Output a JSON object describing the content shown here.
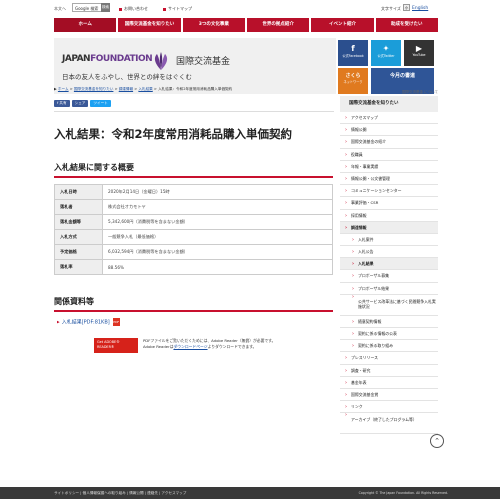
{
  "util": {
    "site_label": "本文へ",
    "search_value": "Google 検索",
    "search_btn": "検索",
    "links": [
      "お問い合わせ",
      "サイトマップ"
    ],
    "fontsize_label": "文字サイズ",
    "fontsize_small": "小",
    "fontsize_mid": "中",
    "fontsize_large": "大",
    "english": "English"
  },
  "gnav": [
    "ホーム",
    "国際交流基金を知りたい",
    "3つの文化事業",
    "世界の拠点紹介",
    "イベント紹介",
    "助成を受けたい"
  ],
  "banner": {
    "en_name_a": "JAPAN",
    "en_name_b": "FOUNDATION",
    "jp_name": "国際交流基金",
    "tagline": "日本の友人をふやし、世界との絆をはぐくむ"
  },
  "social": {
    "facebook": "公式Facebook",
    "twitter": "公式Twitter",
    "youtube": "YouTube",
    "sakura": "さくら",
    "sakura_sub": "ネットワーク",
    "kongetsu": "今月の書道",
    "about": "国際交流基金 について"
  },
  "breadcrumb": {
    "items": [
      "ホーム",
      "国際交流基金を知りたい",
      "調達情報",
      "入札結果"
    ],
    "current": "入札結果：令和2年度常用消耗品購入単価契約"
  },
  "share": {
    "fb": "f 共有",
    "share": "シェア",
    "tweet": "ツイート"
  },
  "main": {
    "title": "入札結果：令和2年度常用消耗品購入単価契約",
    "summary_heading": "入札結果に関する概要",
    "rows": [
      {
        "k": "入札日時",
        "v": "2020年2月14日（金曜日）15時"
      },
      {
        "k": "落札者",
        "v": "株式会社オカモトヤ"
      },
      {
        "k": "落札金額等",
        "v": "5,342,600円（消費税等を含まない金額）"
      },
      {
        "k": "入札方式",
        "v": "一般競争入札（最低価格）"
      },
      {
        "k": "予定価格",
        "v": "6,032,594円（消費税等を含まない金額）"
      },
      {
        "k": "落札率",
        "v": "88.56%"
      }
    ],
    "related_heading": "関係資料等",
    "doc_link": "入札結果[PDF:81KB]",
    "pdf_icon": "PDF",
    "adobe_badge": "Get ADOBE® READER®",
    "adobe_text_a": "PDFファイルをご覧いただくためには、Adobe Reader（無償）が必要です。",
    "adobe_text_b": "Adobe Readerは",
    "adobe_dl": "ダウンロードページ",
    "adobe_text_c": "よりダウンロードできます。"
  },
  "sidebar": {
    "head": "国際交流基金を知りたい",
    "items": [
      {
        "label": "アクセスマップ",
        "level": 0
      },
      {
        "label": "情報公開",
        "level": 0
      },
      {
        "label": "国際交流基金の紹介",
        "level": 0
      },
      {
        "label": "役職員",
        "level": 0
      },
      {
        "label": "年報・事業実績",
        "level": 0
      },
      {
        "label": "情報公開・公文書管理",
        "level": 0
      },
      {
        "label": "コミュニケーションセンター",
        "level": 0
      },
      {
        "label": "事業評価・CSR",
        "level": 0
      },
      {
        "label": "採用情報",
        "level": 0
      },
      {
        "label": "調達情報",
        "level": 0,
        "active": true
      },
      {
        "label": "入札案件",
        "level": 1
      },
      {
        "label": "入札公告",
        "level": 1
      },
      {
        "label": "入札結果",
        "level": 1,
        "active": true
      },
      {
        "label": "プロポーザル募集",
        "level": 1
      },
      {
        "label": "プロポーザル結果",
        "level": 1
      },
      {
        "label": "公共サービス改革法に基づく民間競争入札実施状況",
        "level": 1,
        "tall": true
      },
      {
        "label": "随意契約情報",
        "level": 1
      },
      {
        "label": "契約に係る情報の公表",
        "level": 1
      },
      {
        "label": "契約に係る取り組み",
        "level": 1
      },
      {
        "label": "プレスリリース",
        "level": 0
      },
      {
        "label": "調査・研究",
        "level": 0
      },
      {
        "label": "基金年表",
        "level": 0
      },
      {
        "label": "国際交流基金賞",
        "level": 0
      },
      {
        "label": "リンク",
        "level": 0
      },
      {
        "label": "アーカイブ（終了したプログラム等）",
        "level": 0,
        "tall": true
      }
    ]
  },
  "footer": {
    "links": "サイトポリシー | 個人情報保護への取り組み | 情報公開 | 連絡先 | アクセスマップ",
    "copy": "Copyright © The Japan Foundation. All Rights Reserved."
  },
  "colors": {
    "accent": "#c8102e",
    "link": "#1a4fa0",
    "purple": "#6a3b8e"
  }
}
